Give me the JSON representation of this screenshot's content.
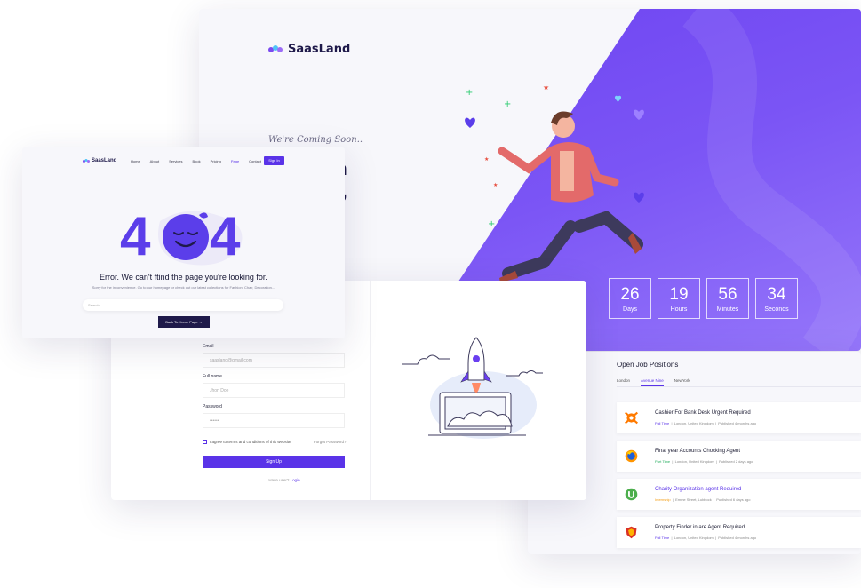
{
  "coming_soon": {
    "brand": "SaasLand",
    "tagline": "We're Coming Soon..",
    "headline": "orking in\n website,\ned!",
    "countdown": [
      {
        "value": "26",
        "label": "Days"
      },
      {
        "value": "19",
        "label": "Hours"
      },
      {
        "value": "56",
        "label": "Minutes"
      },
      {
        "value": "34",
        "label": "Seconds"
      }
    ]
  },
  "error_page": {
    "brand": "SaasLand",
    "nav": [
      "Home",
      "About",
      "Services",
      "Book",
      "Pricing",
      "Page",
      "Contact"
    ],
    "active_nav": "Page",
    "sign_in": "Sign In",
    "code_left": "4",
    "code_right": "4",
    "title": "Error. We can't ftind the page you're looking for.",
    "subtitle": "Sorry for the inconvenience. Go to our homepage or check out our latest collections for Fashion, Chair, Decoration...",
    "search_placeholder": "Search",
    "back_button": "Back To Home Page →"
  },
  "signup": {
    "email_label": "Email",
    "email_placeholder": "saasland@gmail.com",
    "fullname_label": "Full name",
    "fullname_placeholder": "Jhon Doe",
    "password_label": "Password",
    "password_placeholder": "••••••",
    "terms": "I agree to terms and conditions of this website",
    "forgot": "Forgot Password?",
    "submit": "Sign Up",
    "login_prompt": "Have user?",
    "login_link": "Login"
  },
  "jobs": {
    "heading": "Open Job Positions",
    "tabs": [
      "London",
      "Avenue Nine",
      "NewYork"
    ],
    "active_tab": "Avenue Nine",
    "items": [
      {
        "title": "Cashier For Bank Desk Urgent Required",
        "type": "Full Time",
        "type_color": "#5a33e8",
        "location": "London, United Kingdom",
        "posted": "Published 4 months ago",
        "title_color": "#1c1c33"
      },
      {
        "title": "Final year Accounts Chocking Agent",
        "type": "Part Time",
        "type_color": "#27ae60",
        "location": "London, United Kingdom",
        "posted": "Published 2 days ago",
        "title_color": "#1c1c33"
      },
      {
        "title": "Charity Organization agent Required",
        "type": "Internship",
        "type_color": "#f39c12",
        "location": "Emme Street, Lubbock",
        "posted": "Published 6 days ago",
        "title_color": "#5a33e8"
      },
      {
        "title": "Property Finder in are Agent Required",
        "type": "Full Time",
        "type_color": "#5a33e8",
        "location": "London, United Kingdom",
        "posted": "Published 4 months ago",
        "title_color": "#1c1c33"
      }
    ]
  }
}
